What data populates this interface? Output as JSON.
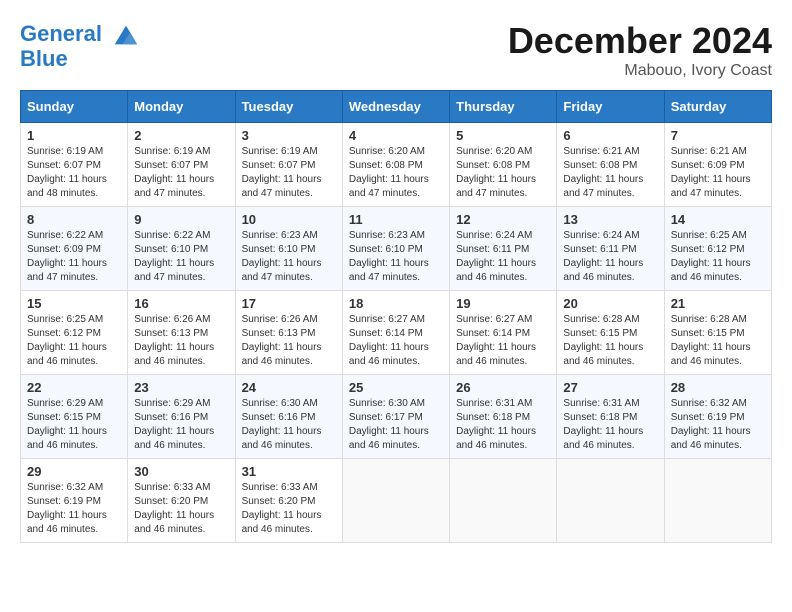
{
  "header": {
    "logo_line1": "General",
    "logo_line2": "Blue",
    "month": "December 2024",
    "location": "Mabouo, Ivory Coast"
  },
  "weekdays": [
    "Sunday",
    "Monday",
    "Tuesday",
    "Wednesday",
    "Thursday",
    "Friday",
    "Saturday"
  ],
  "weeks": [
    [
      {
        "day": "1",
        "sunrise": "Sunrise: 6:19 AM",
        "sunset": "Sunset: 6:07 PM",
        "daylight": "Daylight: 11 hours and 48 minutes."
      },
      {
        "day": "2",
        "sunrise": "Sunrise: 6:19 AM",
        "sunset": "Sunset: 6:07 PM",
        "daylight": "Daylight: 11 hours and 47 minutes."
      },
      {
        "day": "3",
        "sunrise": "Sunrise: 6:19 AM",
        "sunset": "Sunset: 6:07 PM",
        "daylight": "Daylight: 11 hours and 47 minutes."
      },
      {
        "day": "4",
        "sunrise": "Sunrise: 6:20 AM",
        "sunset": "Sunset: 6:08 PM",
        "daylight": "Daylight: 11 hours and 47 minutes."
      },
      {
        "day": "5",
        "sunrise": "Sunrise: 6:20 AM",
        "sunset": "Sunset: 6:08 PM",
        "daylight": "Daylight: 11 hours and 47 minutes."
      },
      {
        "day": "6",
        "sunrise": "Sunrise: 6:21 AM",
        "sunset": "Sunset: 6:08 PM",
        "daylight": "Daylight: 11 hours and 47 minutes."
      },
      {
        "day": "7",
        "sunrise": "Sunrise: 6:21 AM",
        "sunset": "Sunset: 6:09 PM",
        "daylight": "Daylight: 11 hours and 47 minutes."
      }
    ],
    [
      {
        "day": "8",
        "sunrise": "Sunrise: 6:22 AM",
        "sunset": "Sunset: 6:09 PM",
        "daylight": "Daylight: 11 hours and 47 minutes."
      },
      {
        "day": "9",
        "sunrise": "Sunrise: 6:22 AM",
        "sunset": "Sunset: 6:10 PM",
        "daylight": "Daylight: 11 hours and 47 minutes."
      },
      {
        "day": "10",
        "sunrise": "Sunrise: 6:23 AM",
        "sunset": "Sunset: 6:10 PM",
        "daylight": "Daylight: 11 hours and 47 minutes."
      },
      {
        "day": "11",
        "sunrise": "Sunrise: 6:23 AM",
        "sunset": "Sunset: 6:10 PM",
        "daylight": "Daylight: 11 hours and 47 minutes."
      },
      {
        "day": "12",
        "sunrise": "Sunrise: 6:24 AM",
        "sunset": "Sunset: 6:11 PM",
        "daylight": "Daylight: 11 hours and 46 minutes."
      },
      {
        "day": "13",
        "sunrise": "Sunrise: 6:24 AM",
        "sunset": "Sunset: 6:11 PM",
        "daylight": "Daylight: 11 hours and 46 minutes."
      },
      {
        "day": "14",
        "sunrise": "Sunrise: 6:25 AM",
        "sunset": "Sunset: 6:12 PM",
        "daylight": "Daylight: 11 hours and 46 minutes."
      }
    ],
    [
      {
        "day": "15",
        "sunrise": "Sunrise: 6:25 AM",
        "sunset": "Sunset: 6:12 PM",
        "daylight": "Daylight: 11 hours and 46 minutes."
      },
      {
        "day": "16",
        "sunrise": "Sunrise: 6:26 AM",
        "sunset": "Sunset: 6:13 PM",
        "daylight": "Daylight: 11 hours and 46 minutes."
      },
      {
        "day": "17",
        "sunrise": "Sunrise: 6:26 AM",
        "sunset": "Sunset: 6:13 PM",
        "daylight": "Daylight: 11 hours and 46 minutes."
      },
      {
        "day": "18",
        "sunrise": "Sunrise: 6:27 AM",
        "sunset": "Sunset: 6:14 PM",
        "daylight": "Daylight: 11 hours and 46 minutes."
      },
      {
        "day": "19",
        "sunrise": "Sunrise: 6:27 AM",
        "sunset": "Sunset: 6:14 PM",
        "daylight": "Daylight: 11 hours and 46 minutes."
      },
      {
        "day": "20",
        "sunrise": "Sunrise: 6:28 AM",
        "sunset": "Sunset: 6:15 PM",
        "daylight": "Daylight: 11 hours and 46 minutes."
      },
      {
        "day": "21",
        "sunrise": "Sunrise: 6:28 AM",
        "sunset": "Sunset: 6:15 PM",
        "daylight": "Daylight: 11 hours and 46 minutes."
      }
    ],
    [
      {
        "day": "22",
        "sunrise": "Sunrise: 6:29 AM",
        "sunset": "Sunset: 6:15 PM",
        "daylight": "Daylight: 11 hours and 46 minutes."
      },
      {
        "day": "23",
        "sunrise": "Sunrise: 6:29 AM",
        "sunset": "Sunset: 6:16 PM",
        "daylight": "Daylight: 11 hours and 46 minutes."
      },
      {
        "day": "24",
        "sunrise": "Sunrise: 6:30 AM",
        "sunset": "Sunset: 6:16 PM",
        "daylight": "Daylight: 11 hours and 46 minutes."
      },
      {
        "day": "25",
        "sunrise": "Sunrise: 6:30 AM",
        "sunset": "Sunset: 6:17 PM",
        "daylight": "Daylight: 11 hours and 46 minutes."
      },
      {
        "day": "26",
        "sunrise": "Sunrise: 6:31 AM",
        "sunset": "Sunset: 6:18 PM",
        "daylight": "Daylight: 11 hours and 46 minutes."
      },
      {
        "day": "27",
        "sunrise": "Sunrise: 6:31 AM",
        "sunset": "Sunset: 6:18 PM",
        "daylight": "Daylight: 11 hours and 46 minutes."
      },
      {
        "day": "28",
        "sunrise": "Sunrise: 6:32 AM",
        "sunset": "Sunset: 6:19 PM",
        "daylight": "Daylight: 11 hours and 46 minutes."
      }
    ],
    [
      {
        "day": "29",
        "sunrise": "Sunrise: 6:32 AM",
        "sunset": "Sunset: 6:19 PM",
        "daylight": "Daylight: 11 hours and 46 minutes."
      },
      {
        "day": "30",
        "sunrise": "Sunrise: 6:33 AM",
        "sunset": "Sunset: 6:20 PM",
        "daylight": "Daylight: 11 hours and 46 minutes."
      },
      {
        "day": "31",
        "sunrise": "Sunrise: 6:33 AM",
        "sunset": "Sunset: 6:20 PM",
        "daylight": "Daylight: 11 hours and 46 minutes."
      },
      null,
      null,
      null,
      null
    ]
  ]
}
